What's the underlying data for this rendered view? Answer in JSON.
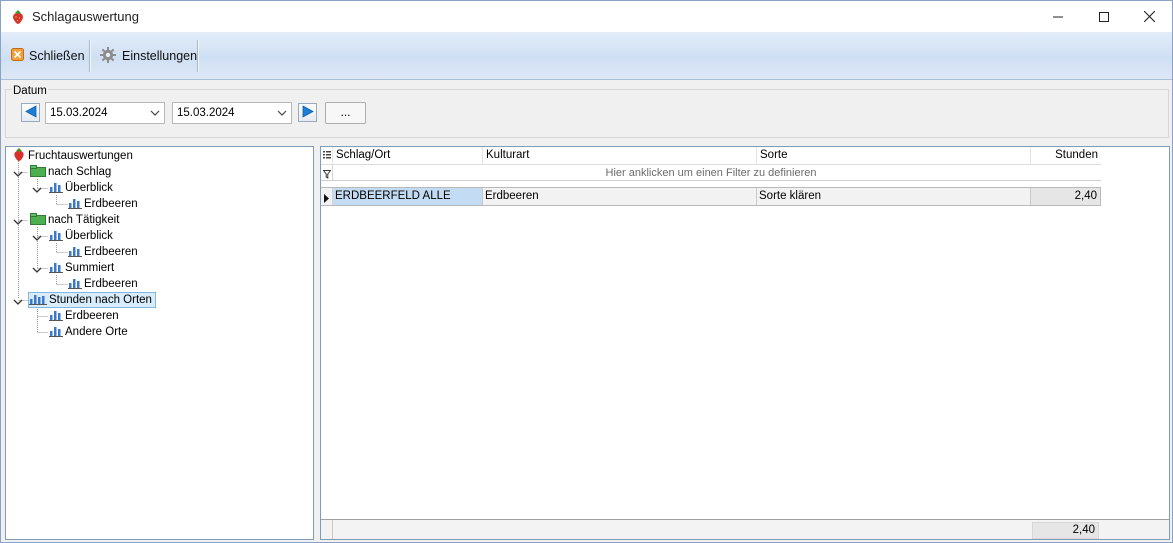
{
  "window": {
    "title": "Schlagauswertung",
    "icon": "strawberry-icon",
    "controls": [
      "minimize-icon",
      "maximize-icon",
      "close-icon"
    ]
  },
  "toolbar": {
    "close_label": "Schließen",
    "settings_label": "Einstellungen"
  },
  "datum": {
    "label": "Datum",
    "from": "15.03.2024",
    "to": "15.03.2024",
    "more_label": "..."
  },
  "tree": {
    "root": "Fruchtauswertungen",
    "nodes": [
      {
        "label": "nach Schlag"
      },
      {
        "label": "Überblick"
      },
      {
        "label": "Erdbeeren"
      },
      {
        "label": "nach Tätigkeit"
      },
      {
        "label": "Überblick"
      },
      {
        "label": "Erdbeeren"
      },
      {
        "label": "Summiert"
      },
      {
        "label": "Erdbeeren"
      },
      {
        "label": "Stunden nach Orten"
      },
      {
        "label": "Erdbeeren"
      },
      {
        "label": "Andere Orte"
      }
    ]
  },
  "grid": {
    "columns": [
      "Schlag/Ort",
      "Kulturart",
      "Sorte",
      "Stunden"
    ],
    "filter_hint": "Hier anklicken um einen Filter zu definieren",
    "rows": [
      {
        "schlag": "ERDBEERFELD ALLE",
        "kulturart": "Erdbeeren",
        "sorte": "Sorte klären",
        "stunden": "2,40"
      }
    ],
    "total": "2,40"
  },
  "colors": {
    "accent_blue": "#1c7fd6",
    "selection": "#c4dcf3",
    "toolbar_gradient_top": "#e3edf9"
  }
}
